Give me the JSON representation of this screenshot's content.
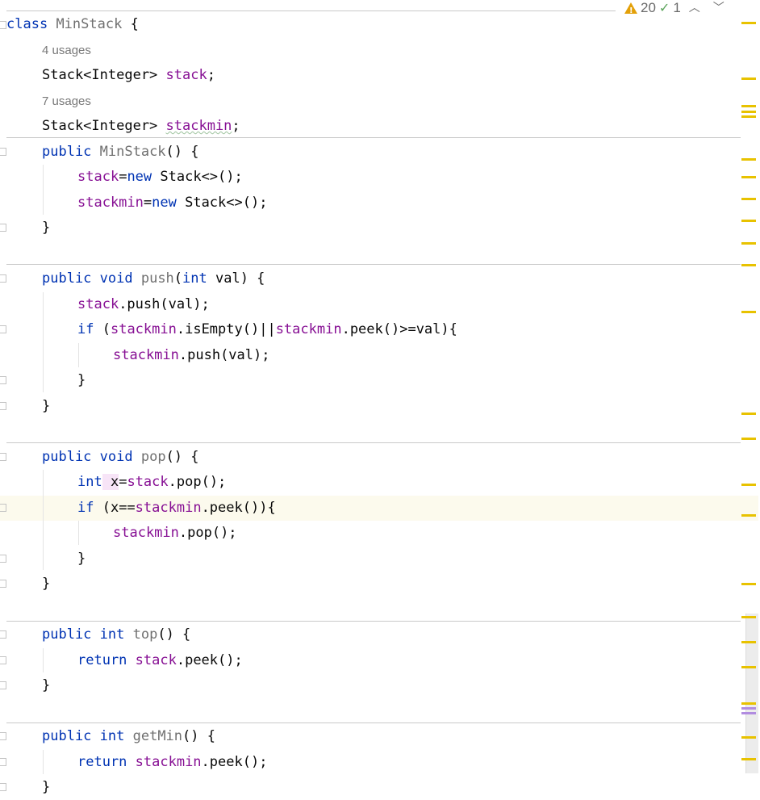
{
  "status": {
    "warnings": "20",
    "typos": "1",
    "prev_icon": "chevron-up-icon",
    "next_icon": "chevron-down-icon"
  },
  "code": {
    "class_kw": "class",
    "class_name": "MinStack",
    "open_brace": " {",
    "usage1": "4 usages",
    "field1_type": "Stack<Integer> ",
    "field1_name": "stack",
    "semi": ";",
    "usage2": "7 usages",
    "field2_type": "Stack<Integer> ",
    "field2_name": "stackmin",
    "ctor_public": "public ",
    "ctor_name": "MinStack",
    "ctor_rest": "() {",
    "ctor_l1_field": "stack",
    "ctor_l1_eq": "=",
    "ctor_l1_new": "new",
    "ctor_l1_rest": " Stack<>();",
    "ctor_l2_field": "stackmin",
    "ctor_l2_eq": "=",
    "ctor_l2_new": "new",
    "ctor_l2_rest": " Stack<>();",
    "close": "}",
    "push_public": "public ",
    "push_void": "void ",
    "push_name": "push",
    "push_paren": "(",
    "push_int": "int",
    "push_rest": " val) {",
    "push_l1_field": "stack",
    "push_l1_rest": ".push(val);",
    "push_if": "if",
    "push_if_open": " (",
    "push_if_f1": "stackmin",
    "push_if_mid": ".isEmpty()||",
    "push_if_f2": "stackmin",
    "push_if_rest": ".peek()>=val){",
    "push_inner_field": "stackmin",
    "push_inner_rest": ".push(val);",
    "pop_public": "public ",
    "pop_void": "void ",
    "pop_name": "pop",
    "pop_rest": "() {",
    "pop_int": "int",
    "pop_x": " x",
    "pop_eq": "=",
    "pop_field": "stack",
    "pop_l1_rest": ".pop();",
    "pop_if": "if",
    "pop_if_open": " (x==",
    "pop_if_field": "stackmin",
    "pop_if_rest": ".peek()){",
    "pop_inner_field": "stackmin",
    "pop_inner_rest": ".pop();",
    "top_public": "public ",
    "top_int": "int ",
    "top_name": "top",
    "top_rest": "() {",
    "top_return": "return ",
    "top_field": "stack",
    "top_ret_rest": ".peek();",
    "getmin_public": "public ",
    "getmin_int": "int ",
    "getmin_name": "getMin",
    "getmin_rest": "() {",
    "getmin_return": "return ",
    "getmin_field": "stackmin",
    "getmin_ret_rest": ".peek();"
  },
  "colors": {
    "keyword": "#0033b3",
    "field": "#871094",
    "marker": "#e8c200"
  }
}
